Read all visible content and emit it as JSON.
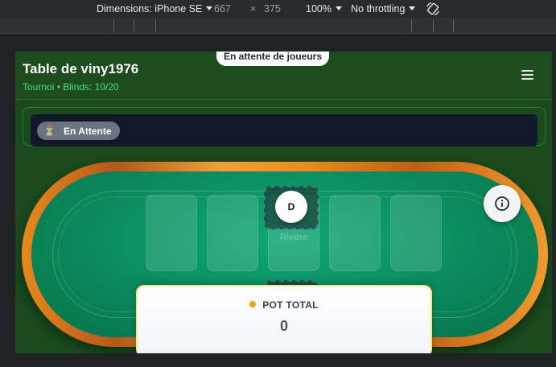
{
  "devtools": {
    "device_label": "Dimensions: iPhone SE",
    "width": "667",
    "times": "×",
    "height": "375",
    "zoom": "100%",
    "throttling": "No throttling",
    "rotate_icon": "rotate-icon"
  },
  "header": {
    "title": "Table de viny1976",
    "subtitle": "Tournoi • Blinds: 10/20",
    "menu_icon": "hamburger-menu-icon"
  },
  "status": {
    "badge_icon": "hourglass-icon",
    "badge_label": "En Attente"
  },
  "table": {
    "waiting_message": "En attente de joueurs",
    "center_slot_label": "Rivière",
    "dealer_label": "D",
    "info_icon": "info-icon",
    "pot_label": "POT TOTAL",
    "pot_value": "0"
  },
  "colors": {
    "rail": "#e8891d",
    "felt": "#0b8a5e",
    "header_bg": "#1d4d1f",
    "subtitle": "#4ade80",
    "pot_dot": "#f59e0b"
  }
}
